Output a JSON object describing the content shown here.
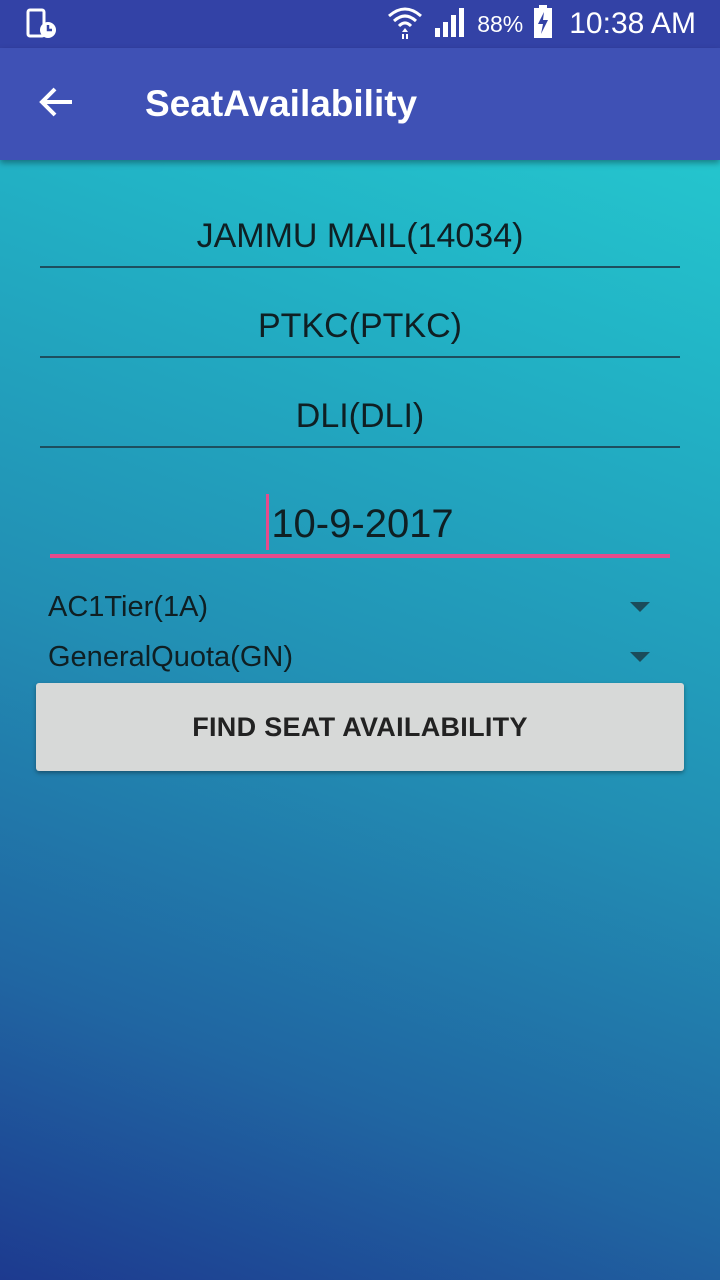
{
  "status_bar": {
    "battery_percent": "88%",
    "time": "10:38 AM",
    "icons": [
      "phone-clock-icon",
      "wifi-icon",
      "signal-icon",
      "battery-charging-icon"
    ]
  },
  "app_bar": {
    "title": "SeatAvailability",
    "back_icon": "arrow-left-icon",
    "color": "#3f51b5"
  },
  "form": {
    "train": "JAMMU MAIL(14034)",
    "from_station": "PTKC(PTKC)",
    "to_station": "DLI(DLI)",
    "date": "10-9-2017",
    "class_selected": "AC1Tier(1A)",
    "quota_selected": "GeneralQuota(GN)",
    "submit_label": "FIND SEAT AVAILABILITY",
    "accent_color": "#e54b8c"
  }
}
